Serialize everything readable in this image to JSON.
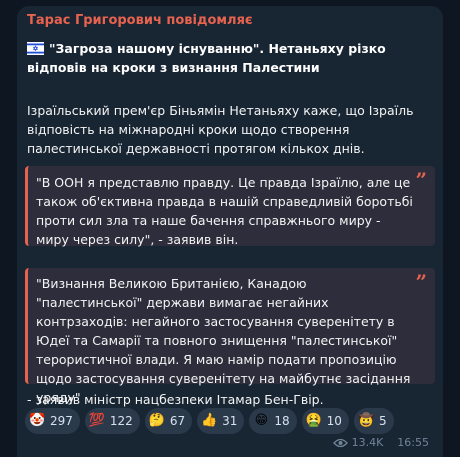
{
  "message": {
    "sender": "Тарас Григорович повідомляє",
    "headline": "\"Загроза нашому існуванню\". Нетаньяху різко відповів на кроки з визнання Палестини",
    "paragraph": "Ізраїльський прем'єр Біньямін Нетаньяху каже, що Ізраїль відповість на міжнародні кроки щодо створення палестинської державності протягом кількох днів.",
    "quote1": "\"В ООН я представлю правду. Це правда Ізраїлю, але це також об'єктивна правда в нашій справедливій боротьбі проти сил зла та наше бачення справжнього миру - миру через силу\", - заявив він.",
    "quote2": "\"Визнання Великою Британією, Канадою \"палестинської\" держави вимагає негайних контрзаходів: негайного застосування суверенітету в Юдеї та Самарії та повного знищення \"палестинської\" терористичної влади. Я маю намір подати пропозицію щодо застосування суверенітету на майбутнє засідання уряду\"",
    "footer": "- заявив міністр нацбезпеки Ітамар Бен-Гвір.",
    "quote_mark": "”",
    "flag_icon": "israel-flag-icon"
  },
  "reactions": [
    {
      "icon": "clown-face-icon",
      "emoji": "🤡",
      "count": "297"
    },
    {
      "icon": "hundred-points-icon",
      "emoji": "💯",
      "count": "122"
    },
    {
      "icon": "thinking-face-icon",
      "emoji": "🤔",
      "count": "67"
    },
    {
      "icon": "thumbs-up-icon",
      "emoji": "👍",
      "count": "31"
    },
    {
      "icon": "grinning-face-icon",
      "emoji": "😁",
      "count": "18"
    },
    {
      "icon": "vomiting-face-icon",
      "emoji": "🤮",
      "count": "10"
    },
    {
      "icon": "cowboy-face-icon",
      "emoji": "🤠",
      "count": "5"
    }
  ],
  "meta": {
    "views": "13.4K",
    "time": "16:55",
    "views_icon": "eye-icon"
  },
  "colors": {
    "background": "#0e1621",
    "bubble": "#182533",
    "accent": "#e8634f",
    "text": "#f5f5f5",
    "meta": "#708499"
  }
}
